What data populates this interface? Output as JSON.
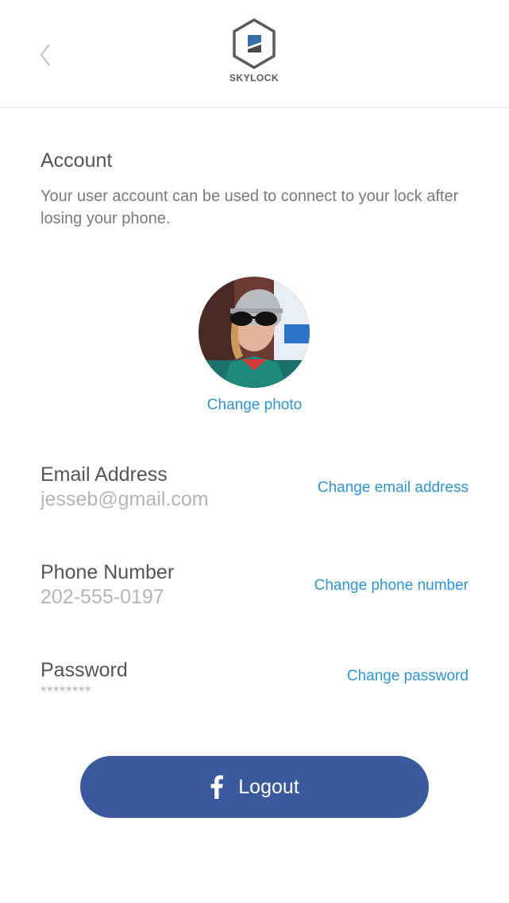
{
  "header": {
    "logo_text": "SKYLOCK",
    "back_icon": "chevron-left-icon",
    "logo_icon": "skylock-hexagon-icon"
  },
  "account": {
    "title": "Account",
    "description": "Your user account can be used to connect to your lock after losing your phone."
  },
  "photo": {
    "change_label": "Change photo"
  },
  "fields": {
    "email": {
      "label": "Email Address",
      "value": "jesseb@gmail.com",
      "action": "Change email address"
    },
    "phone": {
      "label": "Phone Number",
      "value": "202-555-0197",
      "action": "Change phone number"
    },
    "password": {
      "label": "Password",
      "value": "********",
      "action": "Change password"
    }
  },
  "logout": {
    "label": "Logout",
    "icon": "facebook-icon"
  },
  "colors": {
    "accent": "#2f95d4",
    "facebook": "#3b5a9e",
    "label_text": "#555555",
    "value_text": "#b5b5b5"
  }
}
